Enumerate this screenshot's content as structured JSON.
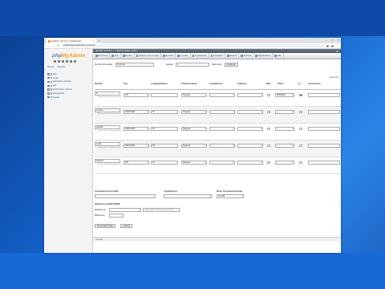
{
  "browser": {
    "tab_title": "localhost / 127.0.0.1 | phpMyAdmin",
    "url": "localhost/phpmyadmin/tbl_create.php"
  },
  "sidebar": {
    "logo_php": "php",
    "logo_my": "MyAdmin",
    "tabs": [
      "Recent",
      "Favorites"
    ],
    "tree": [
      {
        "label": "New",
        "expanded": false
      },
      {
        "label": "mysql",
        "expanded": false
      },
      {
        "label": "information_schema",
        "expanded": false
      },
      {
        "label": "test",
        "expanded": false
      },
      {
        "label": "performance_schema",
        "expanded": false
      },
      {
        "label": "phpmyadmin",
        "expanded": false
      },
      {
        "label": "prueba",
        "expanded": false
      }
    ]
  },
  "breadcrumb": {
    "server": "Servidor: 127.0.0.1",
    "database": "Base de datos: prueba"
  },
  "menu": [
    "Estructura",
    "SQL",
    "Buscar",
    "Generar una consulta",
    "Exportar",
    "Importar",
    "Operaciones",
    "Privilegios",
    "Rutinas",
    "Eventos",
    "Disparadores",
    "Más"
  ],
  "table_name_row": {
    "name_label": "Nombre de la tabla:",
    "name_value": "Personas",
    "add_label": "Agregar",
    "add_count": "1",
    "columns_label": "columna(s)",
    "go_button": "Continuar"
  },
  "structure_link": "Estructura",
  "headers": [
    "Nombre",
    "Tipo",
    "Longitud/Valores",
    "Predeterminado",
    "Cotejamiento",
    "Atributos",
    "Nulo",
    "Índice",
    "A_I",
    "Comentarios"
  ],
  "rows": [
    {
      "name": "id",
      "sub": "Escoge de la columna central",
      "type": "INT",
      "length": "",
      "default": "Ninguna",
      "index": "PRIMARY",
      "ai": true
    },
    {
      "name": "nombre",
      "sub": "Escoge de la columna central",
      "type": "VARCHAR",
      "length": "50",
      "default": "Ninguna",
      "index": "---",
      "ai": false
    },
    {
      "name": "apellido",
      "sub": "Escoge de la columna central",
      "type": "VARCHAR",
      "length": "50",
      "default": "Ninguna",
      "index": "---",
      "ai": false
    },
    {
      "name": "email",
      "sub": "Escoge de la columna central",
      "type": "VARCHAR",
      "length": "60",
      "default": "Ninguna",
      "index": "---",
      "ai": false
    },
    {
      "name": "telefono",
      "sub": "Escoge de la columna central",
      "type": "INT",
      "length": "10",
      "default": "Ninguna",
      "index": "---",
      "ai": false
    }
  ],
  "lower": {
    "table_comments_label": "Comentarios de la tabla:",
    "collation_label": "Cotejamiento:",
    "engine_label": "Motor de almacenamiento:",
    "engine_value": "InnoDB",
    "partition_label": "Definición de PARTICIÓN:",
    "partition_by": "Partición por:",
    "partitions_placeholder": "( Expresión o lista de columnas )",
    "partitions_label": "Particiones:",
    "preview_button": "Previsualizar SQL",
    "save_button": "Guardar"
  },
  "console_label": "Consola"
}
